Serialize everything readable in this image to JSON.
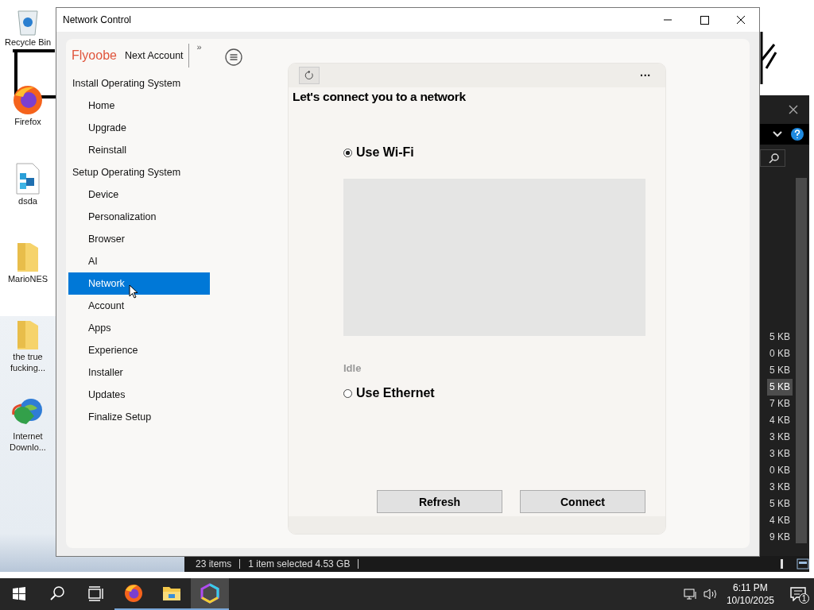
{
  "desktop": {
    "icons": [
      {
        "kind": "recycle",
        "label": "Recycle Bin"
      },
      {
        "kind": "firefox",
        "label": "Firefox"
      },
      {
        "kind": "file",
        "label": "dsda"
      },
      {
        "kind": "folder",
        "label": "MarioNES"
      },
      {
        "kind": "folder",
        "label": "the true fucking..."
      },
      {
        "kind": "downloader",
        "label": "Internet Downlo..."
      }
    ]
  },
  "explorer": {
    "sizes": [
      {
        "text": "5 KB",
        "selected": false
      },
      {
        "text": "0 KB",
        "selected": false
      },
      {
        "text": "5 KB",
        "selected": false
      },
      {
        "text": "5 KB",
        "selected": true
      },
      {
        "text": "7 KB",
        "selected": false
      },
      {
        "text": "4 KB",
        "selected": false
      },
      {
        "text": "3 KB",
        "selected": false
      },
      {
        "text": "3 KB",
        "selected": false
      },
      {
        "text": "0 KB",
        "selected": false
      },
      {
        "text": "3 KB",
        "selected": false
      },
      {
        "text": "5 KB",
        "selected": false
      },
      {
        "text": "4 KB",
        "selected": false
      },
      {
        "text": "9 KB",
        "selected": false
      }
    ],
    "status_items": "23 items",
    "status_selected": "1 item selected  4.53 GB"
  },
  "window": {
    "title": "Network Control",
    "brand": "Flyoobe",
    "next": "Next Account",
    "collapse": "»",
    "sidebar": [
      {
        "label": "Install Operating System",
        "children": [
          {
            "label": "Home",
            "selected": false
          },
          {
            "label": "Upgrade",
            "selected": false
          },
          {
            "label": "Reinstall",
            "selected": false
          }
        ]
      },
      {
        "label": "Setup Operating System",
        "children": [
          {
            "label": "Device",
            "selected": false
          },
          {
            "label": "Personalization",
            "selected": false
          },
          {
            "label": "Browser",
            "selected": false
          },
          {
            "label": "AI",
            "selected": false
          },
          {
            "label": "Network",
            "selected": true
          },
          {
            "label": "Account",
            "selected": false
          },
          {
            "label": "Apps",
            "selected": false
          },
          {
            "label": "Experience",
            "selected": false
          },
          {
            "label": "Installer",
            "selected": false
          },
          {
            "label": "Updates",
            "selected": false
          },
          {
            "label": "Finalize Setup",
            "selected": false
          }
        ]
      }
    ],
    "page": {
      "more": "···",
      "title": "Let's connect you to a network",
      "wifi": {
        "label": "Use Wi-Fi",
        "selected": true
      },
      "status": "Idle",
      "ethernet": {
        "label": "Use Ethernet",
        "selected": false
      },
      "buttons": [
        "Refresh",
        "Connect"
      ]
    }
  },
  "taskbar": {
    "apps": [
      {
        "kind": "firefox",
        "selected": false
      },
      {
        "kind": "folder",
        "selected": false
      },
      {
        "kind": "hexagon",
        "selected": true
      }
    ],
    "time": "6:11 PM",
    "date": "10/10/2025",
    "notifications": "1"
  }
}
